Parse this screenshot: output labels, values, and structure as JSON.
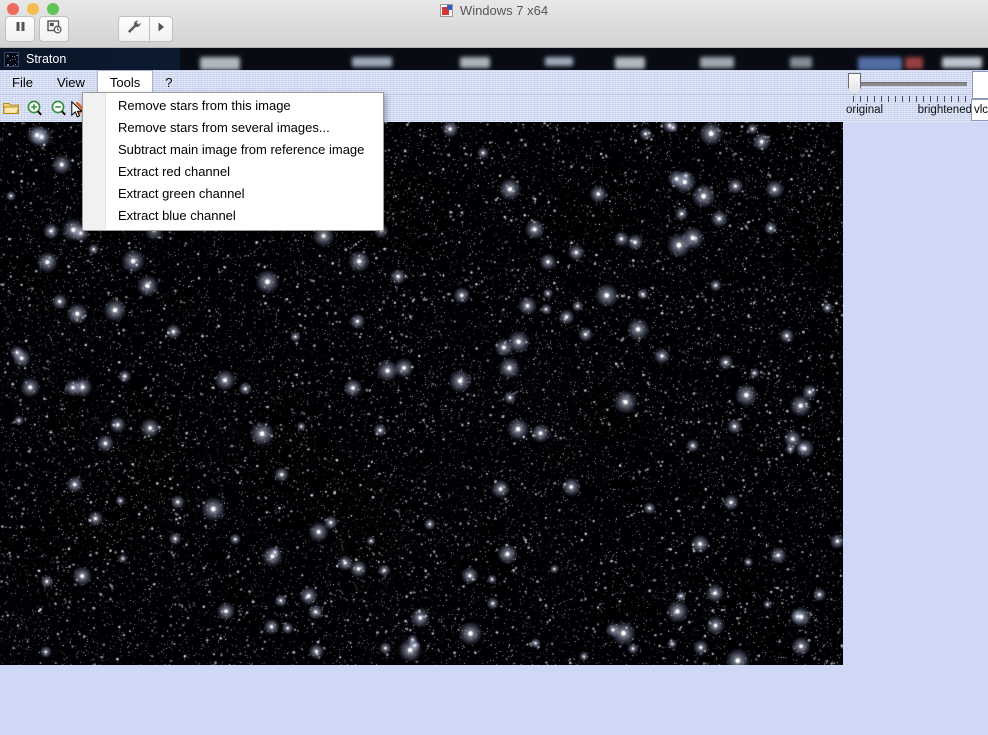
{
  "host": {
    "window_title": "Windows 7 x64",
    "window_icon": "vm-app-icon",
    "traffic_lights": [
      "close-button",
      "minimize-button",
      "maximize-button"
    ],
    "buttons": [
      {
        "name": "pause-vm-button",
        "icon": "pause-icon"
      },
      {
        "name": "snapshot-button",
        "icon": "snapshot-clock-icon"
      },
      {
        "name": "vm-tools-button",
        "icon": "wrench-icon"
      },
      {
        "name": "vm-run-button",
        "icon": "play-triangle-icon"
      }
    ]
  },
  "app": {
    "title": "Straton",
    "icon": "straton-starfield-icon",
    "menus": [
      {
        "label": "File",
        "active": false
      },
      {
        "label": "View",
        "active": false
      },
      {
        "label": "Tools",
        "active": true
      },
      {
        "label": "?",
        "active": false
      }
    ],
    "toolbar_icons": [
      {
        "name": "open-folder-icon",
        "label": "Open"
      },
      {
        "name": "zoom-in-icon",
        "label": "Zoom in"
      },
      {
        "name": "zoom-out-icon",
        "label": "Zoom out"
      },
      {
        "name": "remove-stars-icon",
        "label": "Remove stars"
      }
    ],
    "dropdown": {
      "owner": "Tools",
      "items": [
        "Remove stars from this image",
        "Remove stars from several images...",
        "Subtract main image from reference image",
        "Extract red channel",
        "Extract green channel",
        "Extract blue channel"
      ]
    },
    "brightness": {
      "left_label": "original",
      "right_label": "brightened",
      "value": 0,
      "min": 0,
      "max": 100
    },
    "edge_field": {
      "value": "vlc"
    },
    "image": {
      "name": "starfield-image",
      "description": "astronomical star field"
    }
  },
  "colors": {
    "desktop_background": "#d0d8f8",
    "menubar_background": "#cdd7f2",
    "app_titlebar": "#0a1628",
    "image_background": "#000004",
    "accent_red": "#d8342b"
  }
}
